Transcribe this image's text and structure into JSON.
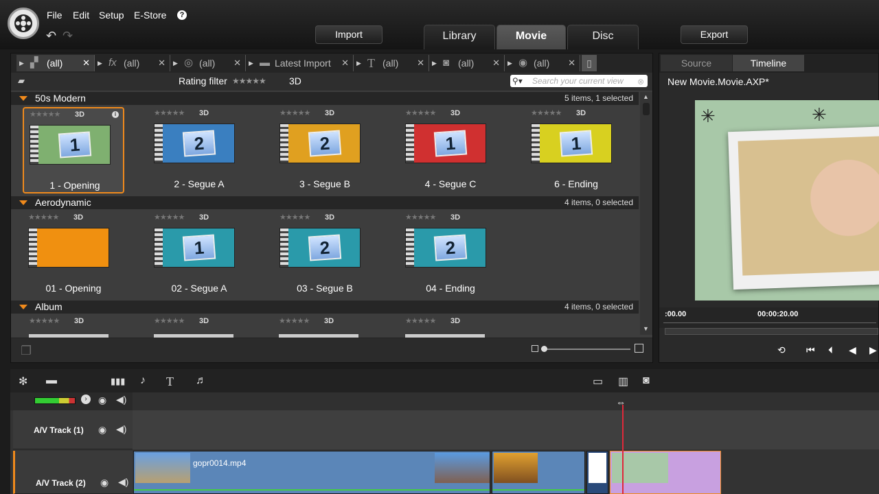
{
  "menu": {
    "file": "File",
    "edit": "Edit",
    "setup": "Setup",
    "estore": "E-Store",
    "help": "?"
  },
  "toolbar": {
    "import": "Import",
    "export": "Export"
  },
  "mode_tabs": {
    "library": "Library",
    "movie": "Movie",
    "disc": "Disc"
  },
  "library": {
    "tabs": [
      {
        "label": "(all)",
        "icon": "media-icon"
      },
      {
        "label": "(all)",
        "icon": "fx-icon"
      },
      {
        "label": "(all)",
        "icon": "film-reel-icon"
      },
      {
        "label": "Latest Import",
        "icon": "folder-icon"
      },
      {
        "label": "(all)",
        "icon": "title-icon"
      },
      {
        "label": "(all)",
        "icon": "camera-icon"
      },
      {
        "label": "(all)",
        "icon": "disc-icon"
      }
    ],
    "rating_filter_label": "Rating filter",
    "rating_stars": "★★★★★",
    "three_d": "3D",
    "search_placeholder": "Search your current view",
    "groups": [
      {
        "name": "50s Modern",
        "count": "5 items, 1 selected",
        "items": [
          {
            "label": "1 - Opening",
            "num": "1",
            "color": "#7fb070",
            "selected": true
          },
          {
            "label": "2 - Segue A",
            "num": "2",
            "color": "#3a7fc0",
            "selected": false
          },
          {
            "label": "3 - Segue B",
            "num": "2",
            "color": "#e0a020",
            "selected": false
          },
          {
            "label": "4 - Segue C",
            "num": "1",
            "color": "#d03030",
            "selected": false
          },
          {
            "label": "6 - Ending",
            "num": "1",
            "color": "#d8d020",
            "selected": false
          }
        ]
      },
      {
        "name": "Aerodynamic",
        "count": "4 items, 0 selected",
        "items": [
          {
            "label": "01 - Opening",
            "num": "",
            "color": "#f09010",
            "selected": false
          },
          {
            "label": "02 - Segue A",
            "num": "1",
            "color": "#2a9aaa",
            "selected": false
          },
          {
            "label": "03 - Segue B",
            "num": "2",
            "color": "#2a9aaa",
            "selected": false
          },
          {
            "label": "04 - Ending",
            "num": "2",
            "color": "#2a9aaa",
            "selected": false
          }
        ]
      },
      {
        "name": "Album",
        "count": "4 items, 0 selected"
      }
    ]
  },
  "preview": {
    "tab_source": "Source",
    "tab_timeline": "Timeline",
    "title": "New Movie.Movie.AXP*",
    "ruler": [
      ":00.00",
      "00:00:20.00"
    ]
  },
  "timeline": {
    "tracks": [
      {
        "name": "A/V Track (1)"
      },
      {
        "name": "A/V Track (2)"
      }
    ],
    "clips": [
      {
        "label": "gopr0014.mp4"
      }
    ]
  }
}
